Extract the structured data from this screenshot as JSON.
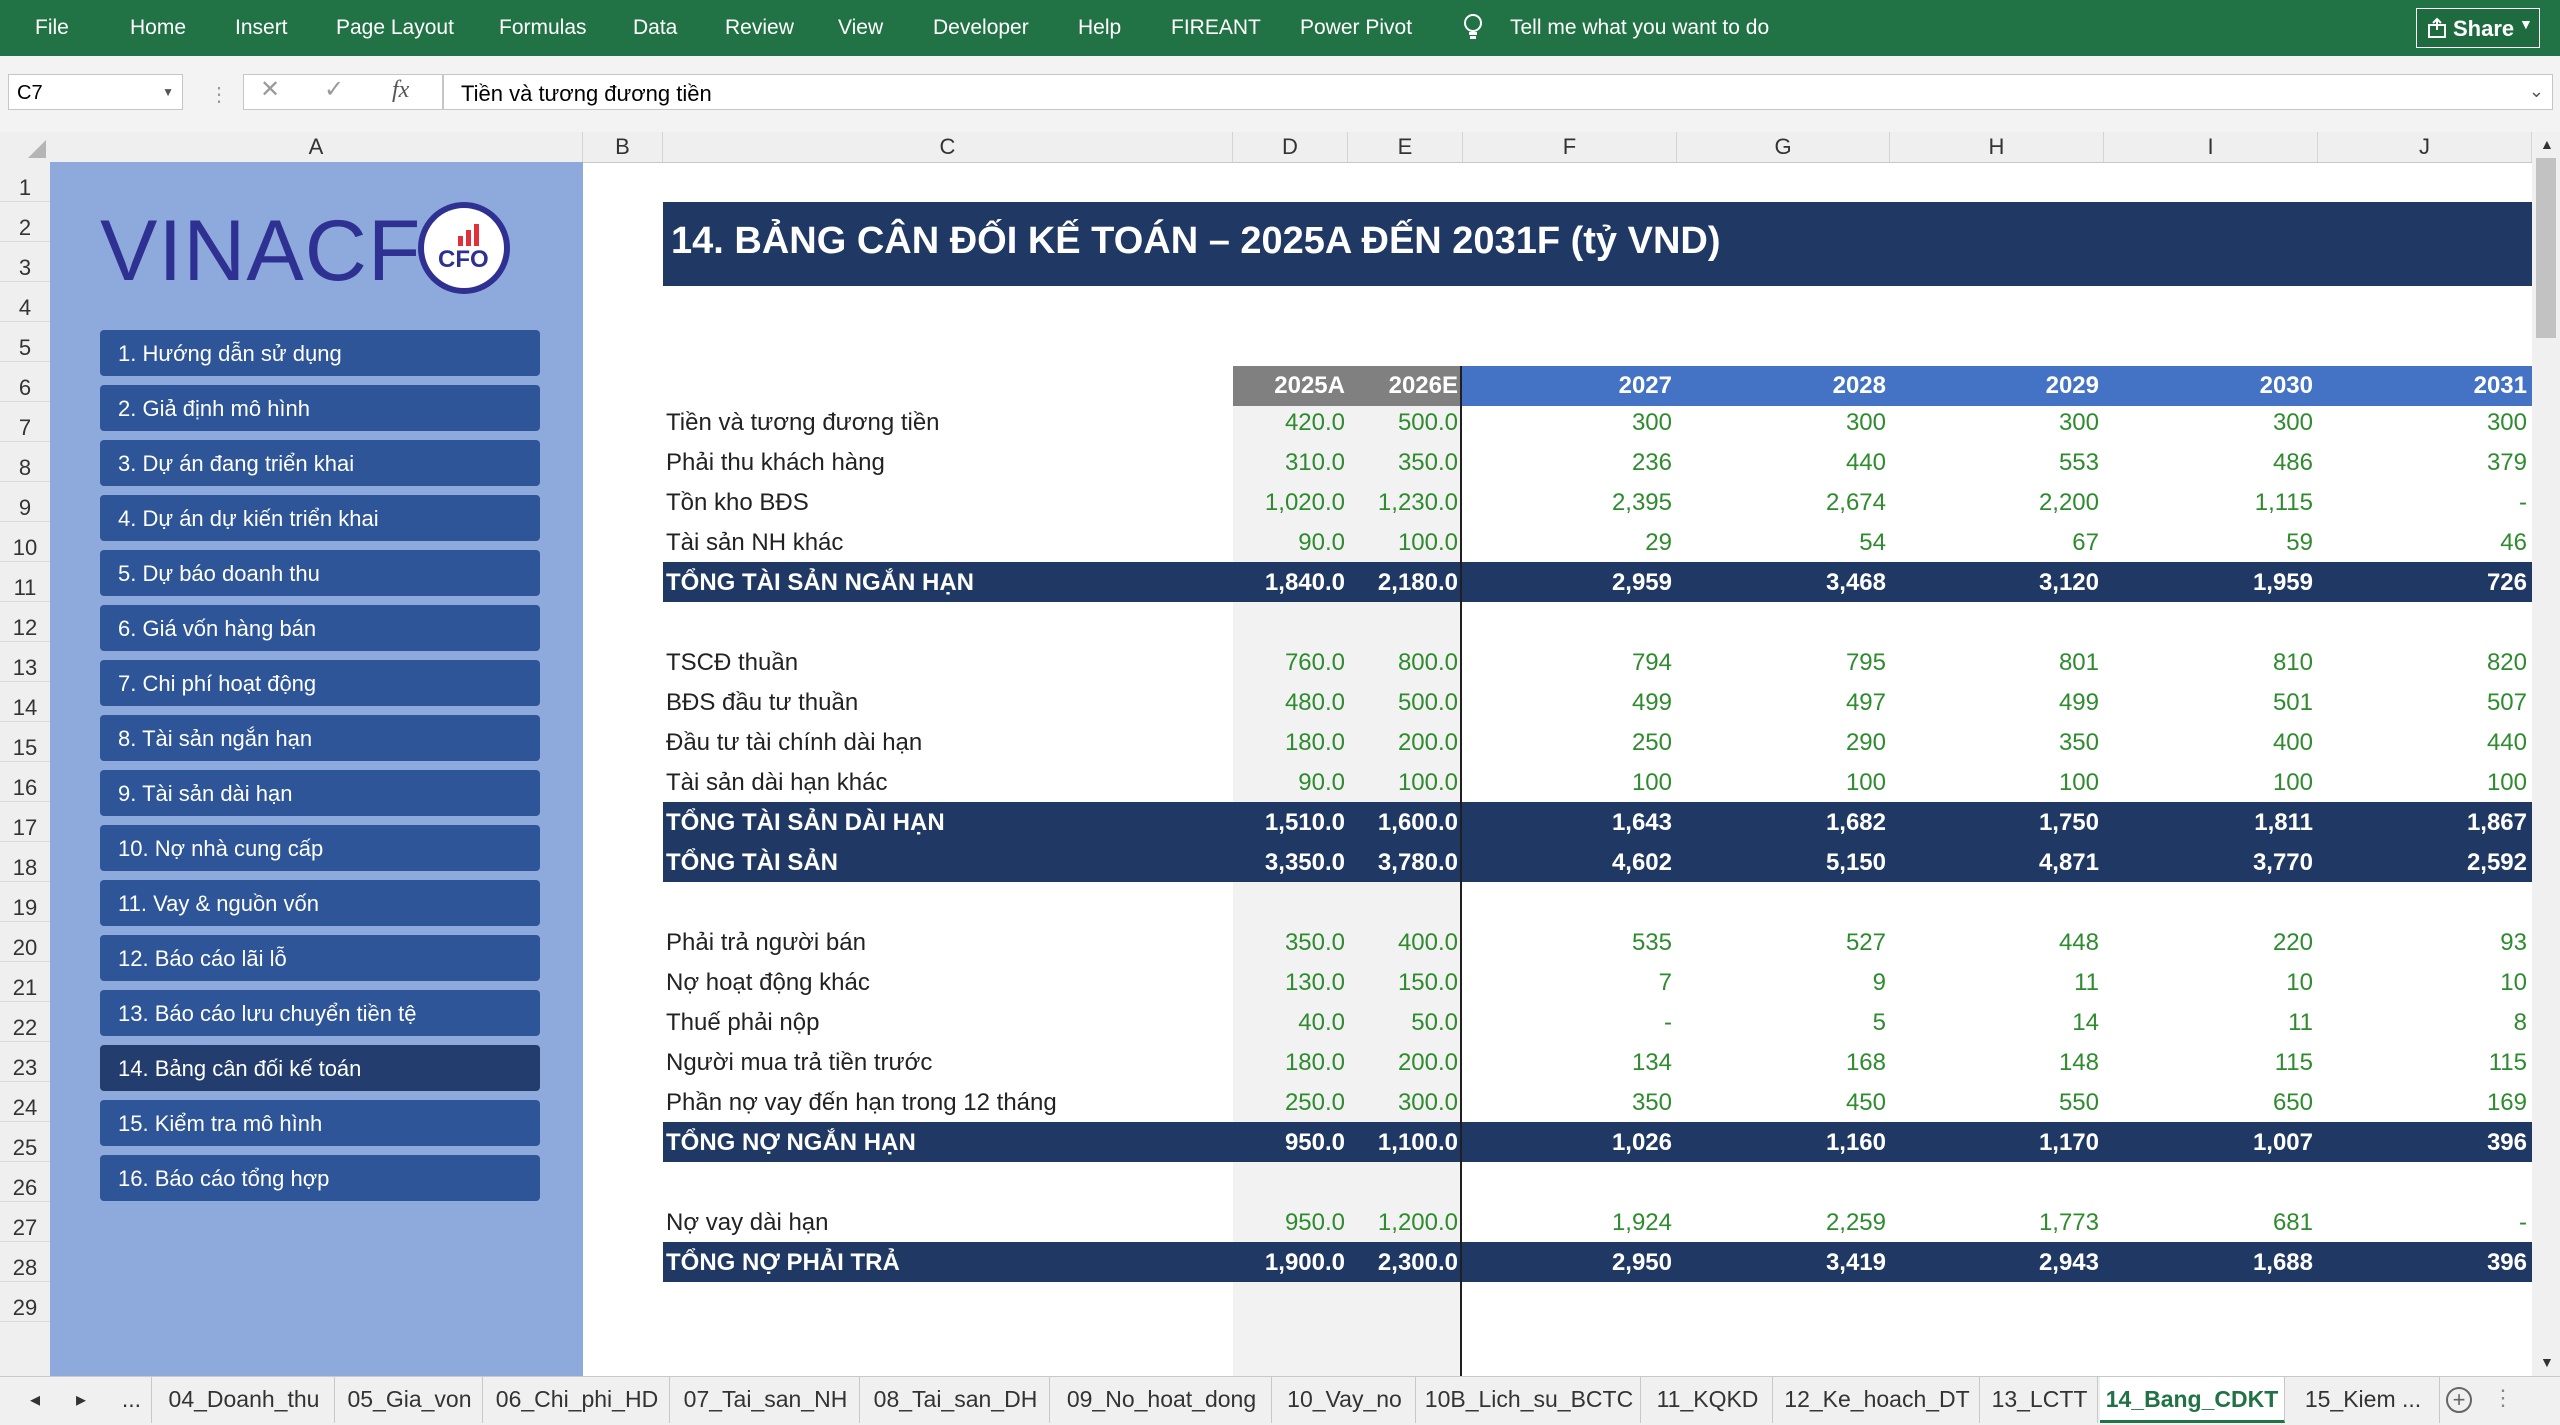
{
  "ribbon": {
    "menu": [
      "File",
      "Home",
      "Insert",
      "Page Layout",
      "Formulas",
      "Data",
      "Review",
      "View",
      "Developer",
      "Help",
      "FIREANT",
      "Power Pivot"
    ],
    "tell_me": "Tell me what you want to do",
    "share": "Share"
  },
  "formula_bar": {
    "cell_ref": "C7",
    "formula": "Tiền và tương đương tiền",
    "fx": "fx"
  },
  "columns": [
    "A",
    "B",
    "C",
    "D",
    "E",
    "F",
    "G",
    "H",
    "I",
    "J"
  ],
  "rows": [
    "1",
    "2",
    "3",
    "4",
    "5",
    "6",
    "7",
    "8",
    "9",
    "10",
    "11",
    "12",
    "13",
    "14",
    "15",
    "16",
    "17",
    "18",
    "19",
    "20",
    "21",
    "22",
    "23",
    "24",
    "25",
    "26",
    "27",
    "28",
    "29"
  ],
  "logo": {
    "text": "VINACF",
    "badge": "CFO"
  },
  "nav": [
    "1. Hướng dẫn sử dụng",
    "2. Giả định mô hình",
    "3. Dự án đang triển khai",
    "4. Dự án dự kiến triển khai",
    "5. Dự báo doanh thu",
    "6. Giá vốn hàng bán",
    "7. Chi phí hoạt động",
    "8. Tài sản ngắn hạn",
    "9. Tài sản dài hạn",
    "10. Nợ nhà cung cấp",
    "11. Vay & nguồn vốn",
    "12. Báo cáo lãi lỗ",
    "13. Báo cáo lưu chuyển tiền tệ",
    "14. Bảng cân đối kế toán",
    "15. Kiểm tra mô hình",
    "16. Báo cáo tổng hợp"
  ],
  "nav_active_index": 13,
  "table": {
    "title": "14. BẢNG CÂN ĐỐI KẾ TOÁN – 2025A ĐẾN 2031F (tỷ VND)",
    "years": [
      "2025A",
      "2026E",
      "2027",
      "2028",
      "2029",
      "2030",
      "2031"
    ],
    "rows": [
      {
        "row": 7,
        "label": "Tiền và tương đương tiền",
        "values": [
          "420.0",
          "500.0",
          "300",
          "300",
          "300",
          "300",
          "300"
        ],
        "total": false
      },
      {
        "row": 8,
        "label": "Phải thu khách hàng",
        "values": [
          "310.0",
          "350.0",
          "236",
          "440",
          "553",
          "486",
          "379"
        ],
        "total": false
      },
      {
        "row": 9,
        "label": "Tồn kho BĐS",
        "values": [
          "1,020.0",
          "1,230.0",
          "2,395",
          "2,674",
          "2,200",
          "1,115",
          "-"
        ],
        "total": false
      },
      {
        "row": 10,
        "label": "Tài sản NH khác",
        "values": [
          "90.0",
          "100.0",
          "29",
          "54",
          "67",
          "59",
          "46"
        ],
        "total": false
      },
      {
        "row": 11,
        "label": "TỔNG TÀI SẢN NGẮN HẠN",
        "values": [
          "1,840.0",
          "2,180.0",
          "2,959",
          "3,468",
          "3,120",
          "1,959",
          "726"
        ],
        "total": true
      },
      {
        "row": 13,
        "label": "TSCĐ thuần",
        "values": [
          "760.0",
          "800.0",
          "794",
          "795",
          "801",
          "810",
          "820"
        ],
        "total": false
      },
      {
        "row": 14,
        "label": "BĐS đầu tư thuần",
        "values": [
          "480.0",
          "500.0",
          "499",
          "497",
          "499",
          "501",
          "507"
        ],
        "total": false
      },
      {
        "row": 15,
        "label": "Đầu tư tài chính dài hạn",
        "values": [
          "180.0",
          "200.0",
          "250",
          "290",
          "350",
          "400",
          "440"
        ],
        "total": false
      },
      {
        "row": 16,
        "label": "Tài sản dài hạn khác",
        "values": [
          "90.0",
          "100.0",
          "100",
          "100",
          "100",
          "100",
          "100"
        ],
        "total": false
      },
      {
        "row": 17,
        "label": "TỔNG TÀI SẢN DÀI HẠN",
        "values": [
          "1,510.0",
          "1,600.0",
          "1,643",
          "1,682",
          "1,750",
          "1,811",
          "1,867"
        ],
        "total": true
      },
      {
        "row": 18,
        "label": "TỔNG TÀI SẢN",
        "values": [
          "3,350.0",
          "3,780.0",
          "4,602",
          "5,150",
          "4,871",
          "3,770",
          "2,592"
        ],
        "total": true
      },
      {
        "row": 20,
        "label": "Phải trả người bán",
        "values": [
          "350.0",
          "400.0",
          "535",
          "527",
          "448",
          "220",
          "93"
        ],
        "total": false
      },
      {
        "row": 21,
        "label": "Nợ hoạt động khác",
        "values": [
          "130.0",
          "150.0",
          "7",
          "9",
          "11",
          "10",
          "10"
        ],
        "total": false
      },
      {
        "row": 22,
        "label": "Thuế phải nộp",
        "values": [
          "40.0",
          "50.0",
          "-",
          "5",
          "14",
          "11",
          "8"
        ],
        "total": false
      },
      {
        "row": 23,
        "label": "Người mua trả tiền trước",
        "values": [
          "180.0",
          "200.0",
          "134",
          "168",
          "148",
          "115",
          "115"
        ],
        "total": false
      },
      {
        "row": 24,
        "label": "Phần nợ vay đến hạn trong 12 tháng",
        "values": [
          "250.0",
          "300.0",
          "350",
          "450",
          "550",
          "650",
          "169"
        ],
        "total": false
      },
      {
        "row": 25,
        "label": "TỔNG NỢ NGẮN HẠN",
        "values": [
          "950.0",
          "1,100.0",
          "1,026",
          "1,160",
          "1,170",
          "1,007",
          "396"
        ],
        "total": true
      },
      {
        "row": 27,
        "label": "Nợ vay dài hạn",
        "values": [
          "950.0",
          "1,200.0",
          "1,924",
          "2,259",
          "1,773",
          "681",
          "-"
        ],
        "total": false
      },
      {
        "row": 28,
        "label": "TỔNG NỢ PHẢI TRẢ",
        "values": [
          "1,900.0",
          "2,300.0",
          "2,950",
          "3,419",
          "2,943",
          "1,688",
          "396"
        ],
        "total": true
      }
    ]
  },
  "sheet_tabs": [
    "...",
    "04_Doanh_thu",
    "05_Gia_von",
    "06_Chi_phi_HD",
    "07_Tai_san_NH",
    "08_Tai_san_DH",
    "09_No_hoat_dong",
    "10_Vay_no",
    "10B_Lich_su_BCTC",
    "11_KQKD",
    "12_Ke_hoach_DT",
    "13_LCTT",
    "14_Bang_CDKT",
    "15_Kiem ..."
  ],
  "active_tab": "14_Bang_CDKT",
  "colors": {
    "ribbon": "#217346",
    "nav_panel": "#8ea9db",
    "nav_button": "#2e5597",
    "title_bar": "#1f3864",
    "total_row": "#203864",
    "header_gray": "#808080",
    "header_blue": "#4472c4",
    "value_green": "#2e8b2e"
  },
  "icons": {
    "lightbulb": "lightbulb-icon",
    "share": "share-icon",
    "cancel": "cancel-icon",
    "enter": "check-icon",
    "add_sheet": "plus-circle-icon"
  }
}
